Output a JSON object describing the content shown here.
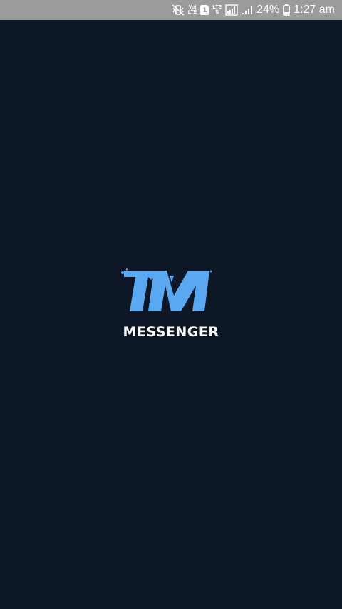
{
  "status_bar": {
    "volte_top": "Vo)",
    "volte_bottom": "LTE",
    "sim_label": "1",
    "lte_label": "LTE",
    "battery_percent": "24%",
    "time": "1:27 am"
  },
  "splash": {
    "logo_letters": "TM",
    "logo_word": "MESSENGER",
    "logo_color": "#5aa8f2",
    "background": "#0d1726"
  }
}
